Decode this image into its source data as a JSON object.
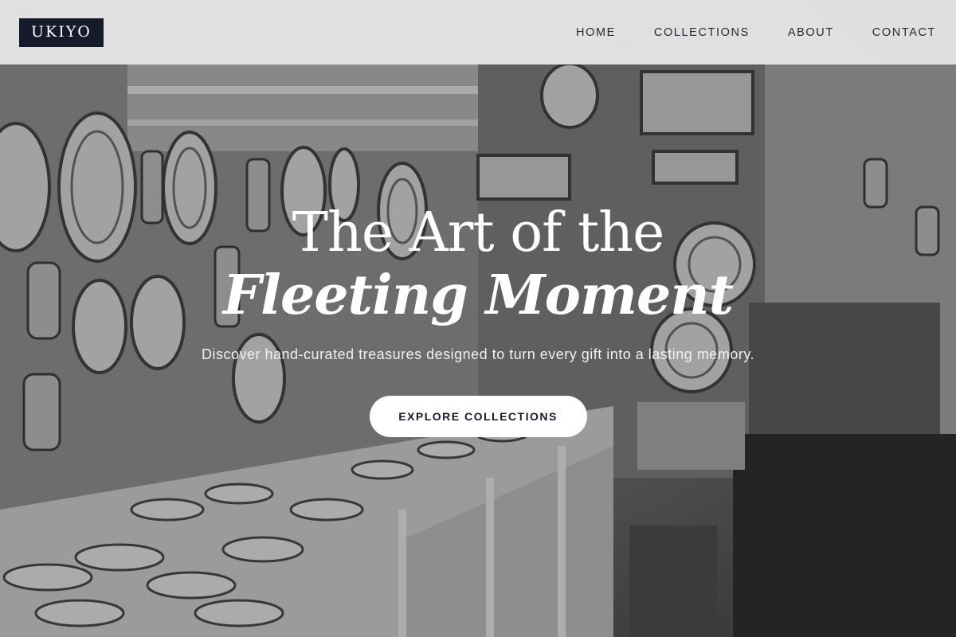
{
  "header": {
    "logo": "UKIYO",
    "nav": [
      {
        "label": "HOME"
      },
      {
        "label": "COLLECTIONS"
      },
      {
        "label": "ABOUT"
      },
      {
        "label": "CONTACT"
      }
    ]
  },
  "hero": {
    "title_line1": "The Art of the",
    "title_line2": "Fleeting Moment",
    "subtitle": "Discover hand-curated treasures designed to turn every gift into a lasting memory.",
    "cta_label": "EXPLORE COLLECTIONS",
    "image": "grayscale photo of a ceramic pottery shop with decorated plates on walls and shelves"
  },
  "colors": {
    "header_bg": "#ececec",
    "logo_bg": "#161b2c",
    "nav_text": "#252a36",
    "cta_bg": "#ffffff",
    "cta_text": "#161b2c",
    "hero_text": "#ffffff"
  }
}
